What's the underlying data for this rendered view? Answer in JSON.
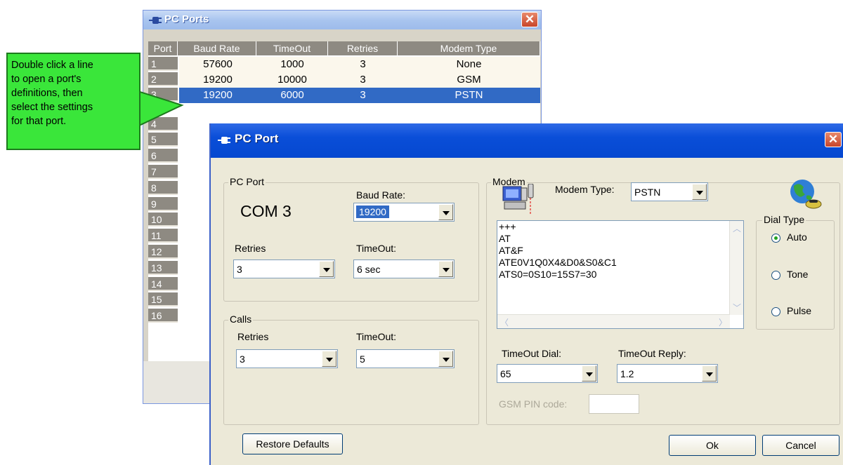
{
  "ports_window": {
    "title": "PC Ports",
    "columns": [
      "Port",
      "Baud Rate",
      "TimeOut",
      "Retries",
      "Modem Type"
    ],
    "rows": [
      {
        "port": "1",
        "baud": "57600",
        "timeout": "1000",
        "retries": "3",
        "modem": "None"
      },
      {
        "port": "2",
        "baud": "19200",
        "timeout": "10000",
        "retries": "3",
        "modem": "GSM"
      },
      {
        "port": "3",
        "baud": "19200",
        "timeout": "6000",
        "retries": "3",
        "modem": "PSTN"
      }
    ],
    "empty_ports": [
      "4",
      "5",
      "6",
      "7",
      "8",
      "9",
      "10",
      "11",
      "12",
      "13",
      "14",
      "15",
      "16"
    ],
    "selected_row": 3
  },
  "callout": {
    "lines": [
      "Double click a line",
      "to open a port's",
      "definitions, then",
      "select the settings",
      "for that port."
    ]
  },
  "dialog": {
    "title": "PC Port",
    "pc_port": {
      "legend": "PC Port",
      "com_label": "COM 3",
      "baud_label": "Baud Rate:",
      "baud_value": "19200",
      "retries_label": "Retries",
      "retries_value": "3",
      "timeout_label": "TimeOut:",
      "timeout_value": "6 sec"
    },
    "calls": {
      "legend": "Calls",
      "retries_label": "Retries",
      "retries_value": "3",
      "timeout_label": "TimeOut:",
      "timeout_value": "5"
    },
    "modem": {
      "legend": "Modem",
      "type_label": "Modem Type:",
      "type_value": "PSTN",
      "init_lines": [
        "+++",
        "AT",
        "AT&F",
        "ATE0V1Q0X4&D0&S0&C1",
        "ATS0=0S10=15S7=30"
      ],
      "timeout_dial_label": "TimeOut Dial:",
      "timeout_dial_value": "65",
      "timeout_reply_label": "TimeOut Reply:",
      "timeout_reply_value": "1.2",
      "gsm_pin_label": "GSM PIN code:",
      "gsm_pin_value": ""
    },
    "dial_type": {
      "legend": "Dial Type",
      "options": [
        "Auto",
        "Tone",
        "Pulse"
      ],
      "selected": "Auto"
    },
    "buttons": {
      "restore": "Restore Defaults",
      "ok": "Ok",
      "cancel": "Cancel"
    }
  },
  "colors": {
    "selection": "#316ac5",
    "callout": "#3ae63a",
    "titlebar_active": "#0a4ed8"
  },
  "icons": [
    "plug-icon",
    "close-icon",
    "modem-icon",
    "globe-phone-icon",
    "chevron-down-icon"
  ]
}
